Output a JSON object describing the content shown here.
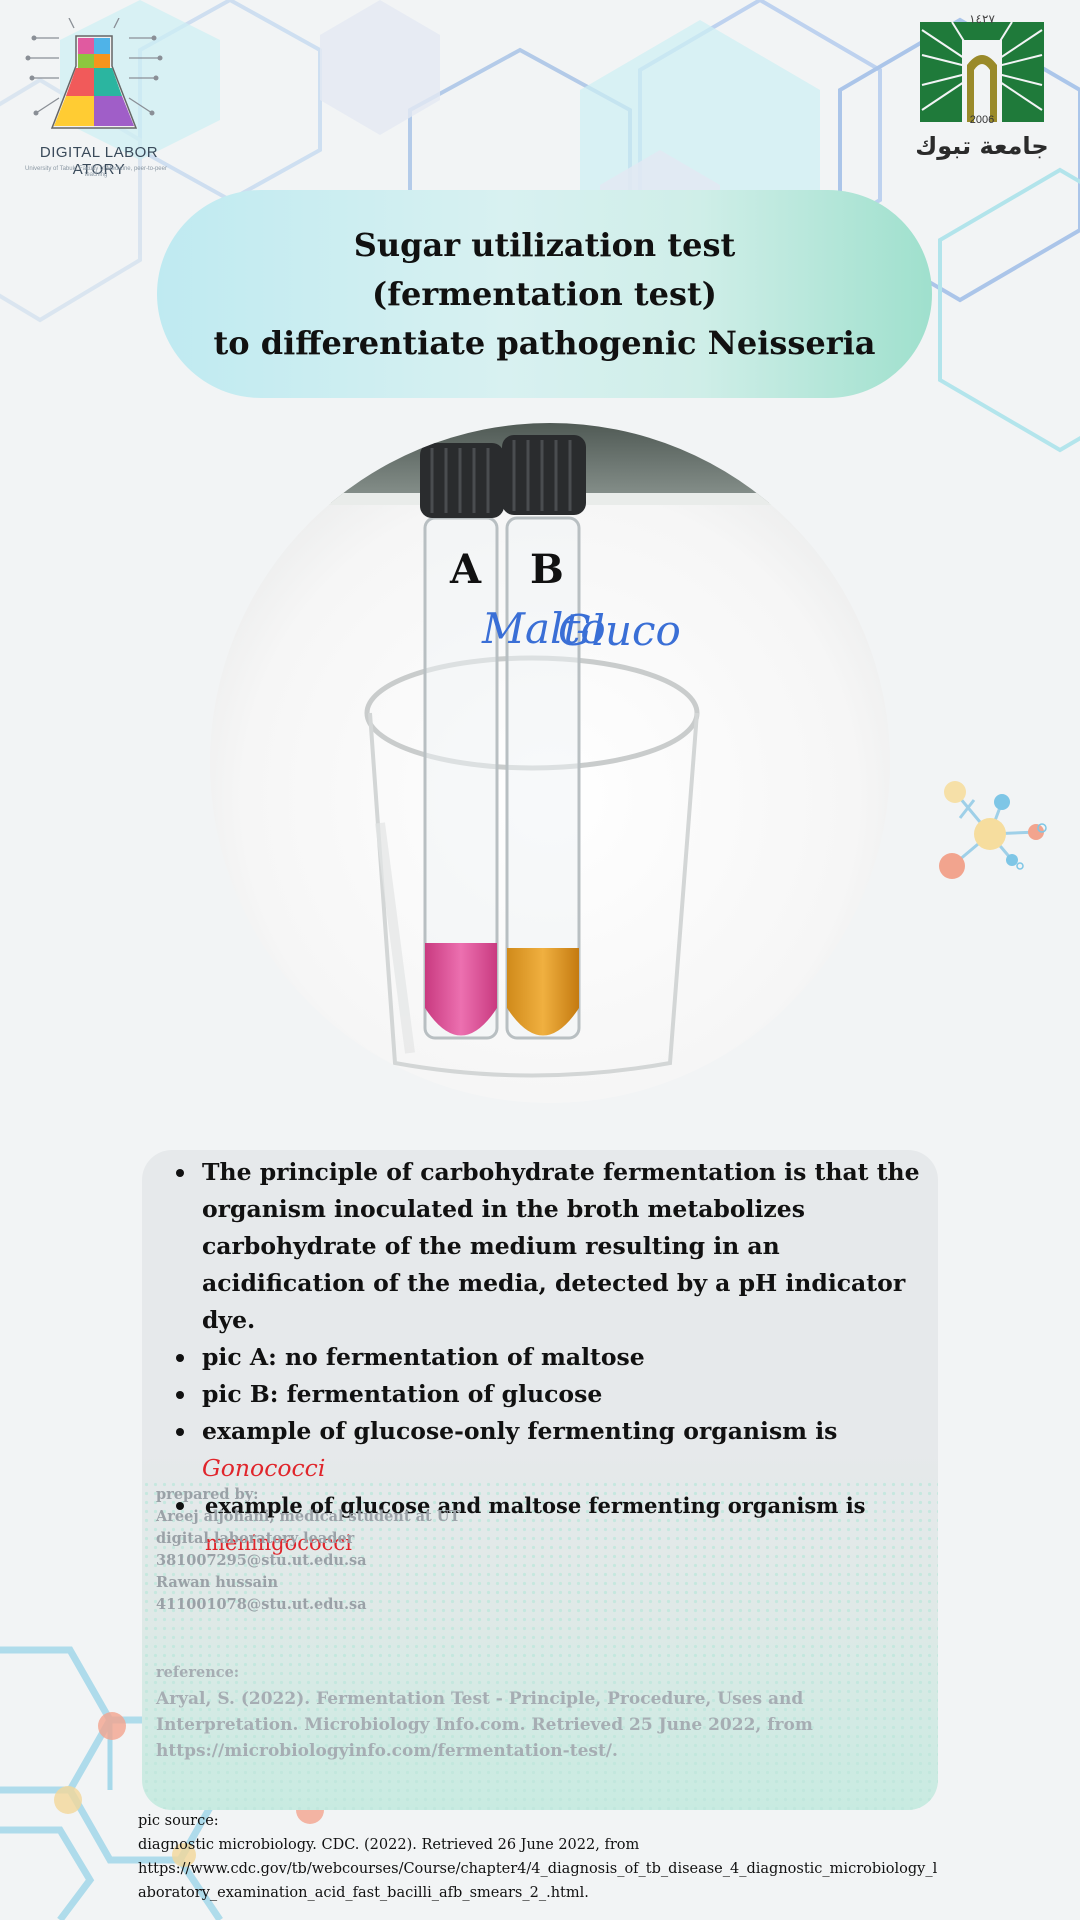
{
  "logo_left": {
    "name": "DIGITAL LABOR  ATORY",
    "subtitle": "University of Tabuk, Faculty of Medicine, peer-to-peer teaching"
  },
  "logo_right": {
    "year_hijri": "١٤٢٧",
    "year": "2006",
    "name": "جامعة تبوك"
  },
  "title": {
    "line1": "Sugar utilization test",
    "line2": "(fermentation test)",
    "line3": "to differentiate pathogenic Neisseria"
  },
  "photo": {
    "label_a": "A",
    "label_b": "B",
    "tube_a_text": "Malto",
    "tube_b_text": "Gluco",
    "tube_a_color": "#e0549a",
    "tube_b_color": "#e8a020"
  },
  "bullets": {
    "item1": "The principle of carbohydrate fermentation is that the organism inoculated in the broth metabolizes carbohydrate of the medium resulting in an acidification of the media, detected by a pH indicator dye.",
    "item2": "pic A: no fermentation of maltose",
    "item3": "pic B:  fermentation of glucose",
    "item4_text": "example of glucose-only fermenting organism is ",
    "item4_org": "Gonococci",
    "item5_text": "example of glucose and maltose fermenting organism is ",
    "item5_org": "meningococci"
  },
  "prepared": {
    "label": "prepared by:",
    "line1": "Areej aljohani, medical student at UT",
    "line2": "digital laboratory leader",
    "line3": "381007295@stu.ut.edu.sa",
    "line4": "Rawan hussain",
    "line5": "411001078@stu.ut.edu.sa"
  },
  "reference": {
    "label": "reference:",
    "text": "Aryal, S. (2022). Fermentation Test - Principle, Procedure, Uses and Interpretation. Microbiology Info.com. Retrieved 25 June 2022, from https://microbiologyinfo.com/fermentation-test/."
  },
  "pic_source": {
    "label": "pic source:",
    "line1": "diagnostic microbiology. CDC. (2022). Retrieved 26 June 2022, from",
    "line2": "https://www.cdc.gov/tb/webcourses/Course/chapter4/4_diagnosis_of_tb_disease_4_diagnostic_microbiology_laboratory_examination_acid_fast_bacilli_afb_smears_2_.html."
  },
  "colors": {
    "accent_red": "#e0252b",
    "title_gradient_start": "#bfeaf1",
    "title_gradient_end": "#9fe0cd",
    "logo_green": "#1f7a3a"
  }
}
